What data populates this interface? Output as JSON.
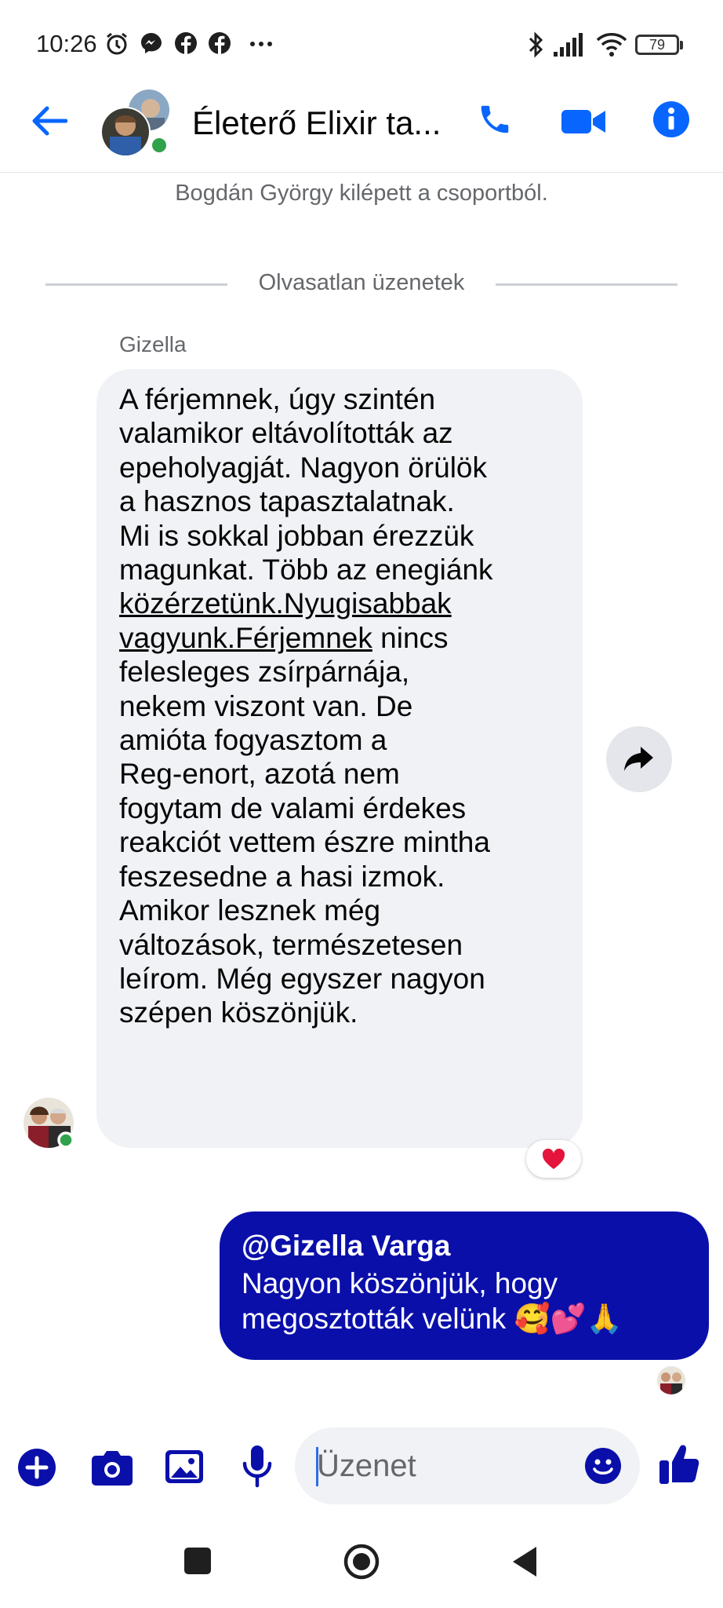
{
  "status_bar": {
    "time": "10:26",
    "battery": "79",
    "left_icons": [
      "alarm-icon",
      "messenger-icon",
      "facebook-icon",
      "facebook-icon",
      "more-icon"
    ],
    "right_icons": [
      "bluetooth-icon",
      "signal-icon",
      "wifi-icon",
      "battery-icon"
    ]
  },
  "header": {
    "title": "Életerő Elixir ta...",
    "online_color": "#31a24c",
    "accent_color": "#0866ff"
  },
  "conversation": {
    "system_note": "Bogdán György kilépett a csoportból.",
    "divider_label": "Olvasatlan üzenetek",
    "incoming": {
      "sender": "Gizella",
      "text_before": "A férjemnek, úgy szintén\nvalamikor eltávolították az\nepeholyagját. Nagyon örülök\na hasznos tapasztalatnak.\nMi is sokkal jobban érezzük\nmagunkat. Több az enegiánk\n",
      "link_1": "közérzetünk.Nyugisabbak",
      "link_2": "vagyunk.Férjemnek",
      "text_after": " nincs\nfelesleges zsírpárnája,\nnekem viszont van. De\namióta fogyasztom a\nReg-enort, azotá nem\nfogytam de valami érdekes\nreakciót vettem észre mintha\nfeszesedne a hasi izmok.\nAmikor lesznek még\nváltozások, természetesen\nleírom. Még egyszer nagyon\nszépen köszönjük.",
      "reaction": "❤️"
    },
    "outgoing": {
      "mention": "@Gizella Varga",
      "text": "Nagyon köszönjük, hogy megosztották velünk 🥰💕🙏",
      "bubble_color": "#0a0faa"
    }
  },
  "composer": {
    "placeholder": "Üzenet"
  }
}
